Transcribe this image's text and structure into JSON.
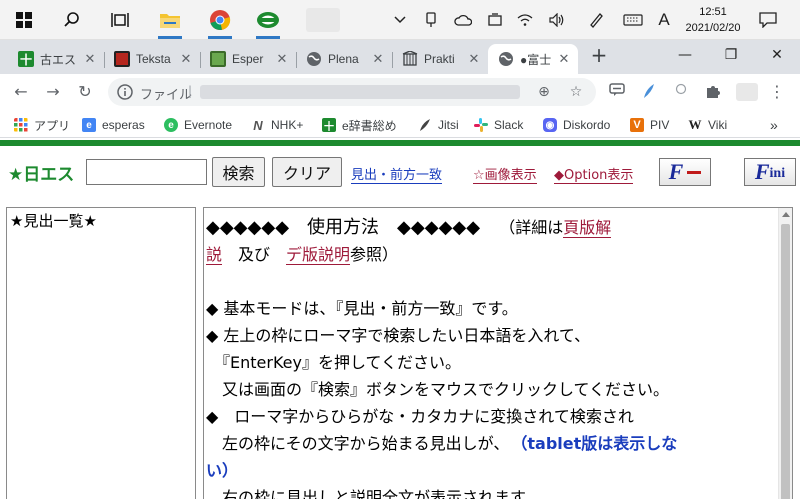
{
  "taskbar": {
    "apps": [
      {
        "name": "start",
        "label": ""
      },
      {
        "name": "search",
        "label": ""
      },
      {
        "name": "task-view",
        "label": ""
      },
      {
        "name": "file-explorer",
        "label": ""
      },
      {
        "name": "chrome",
        "label": ""
      },
      {
        "name": "app-green",
        "label": ""
      }
    ],
    "ime_mode": "A",
    "clock_time": "12:51",
    "clock_date": "2021/02/20"
  },
  "tabs": [
    {
      "label": "古エス",
      "icon_color": "#1d8a2f",
      "icon": "plus-cross-icon"
    },
    {
      "label": "Teksta",
      "icon_color": "#b5261e",
      "icon": "book-icon"
    },
    {
      "label": "Esper",
      "icon_color": "#6aa84f",
      "icon": "book-icon"
    },
    {
      "label": "Plena",
      "icon_color": "#5f6368",
      "icon": "globe-icon"
    },
    {
      "label": "Prakti",
      "icon_color": "#5f6368",
      "icon": "building-icon"
    },
    {
      "label": "●富士",
      "icon_color": "#5f6368",
      "icon": "globe-icon",
      "active": true
    }
  ],
  "toolbar": {
    "back": "←",
    "forward": "→",
    "reload": "↻",
    "omnibox_prefix": "ファイル",
    "zoom": "⊕",
    "star": "☆",
    "menu": "⋮"
  },
  "bookmarks": [
    {
      "label": "アプリ",
      "icon": "apps-grid-icon",
      "color": "#ea4335"
    },
    {
      "label": "esperas",
      "icon": "esperas-icon",
      "color": "#4285f4"
    },
    {
      "label": "Evernote",
      "icon": "evernote-icon",
      "color": "#2dbe60"
    },
    {
      "label": "NHK+",
      "icon": "nhk-icon",
      "color": "#555555"
    },
    {
      "label": "e辞書総め",
      "icon": "plus-cross-icon",
      "color": "#1d8a2f"
    },
    {
      "label": "Jitsi",
      "icon": "jitsi-icon",
      "color": "#444444"
    },
    {
      "label": "Slack",
      "icon": "slack-icon",
      "color": "#e01e5a"
    },
    {
      "label": "Diskordo",
      "icon": "discord-icon",
      "color": "#5865f2"
    },
    {
      "label": "PIV",
      "icon": "piv-icon",
      "color": "#e8710a"
    },
    {
      "label": "Viki",
      "icon": "wikipedia-icon",
      "color": "#222222"
    }
  ],
  "bookmarks_more": "»",
  "page": {
    "brand": "★日エス",
    "search_value": "",
    "search_button": "検索",
    "clear_button": "クリア",
    "mode_link": "見出・前方一致",
    "image_link": "☆画像表示",
    "option_link": "◆Option表示",
    "f_button_1": "F",
    "f_button_2": "F",
    "f_button_2_suffix": "ini",
    "left_title": "★見出一覧★",
    "content": {
      "heading": "◆◆◆◆◆◆　使用方法　◆◆◆◆◆◆",
      "detail_prefix": "（詳細は",
      "link_page": "頁版解",
      "line2_link_cont": "説",
      "line2_and": "　及び　",
      "link_desc": "デ版説明",
      "line2_suffix": "参照）",
      "p1": "◆ 基本モードは、『見出・前方一致』です。",
      "p2": "◆ 左上の枠にローマ字で検索したい日本語を入れて、",
      "p3": "　『EnterKey』を押してください。",
      "p4": "　又は画面の『検索』ボタンをマウスでクリックしてください。",
      "p5": "◆　ローマ字からひらがな・カタカナに変換されて検索され",
      "p6": "　左の枠にその文字から始まる見出しが、",
      "p6_bold": "（tablet版は表示しな",
      "p7_bold": "い）",
      "p8": "　右の枠に見出しと説明全文が表示されます"
    }
  }
}
